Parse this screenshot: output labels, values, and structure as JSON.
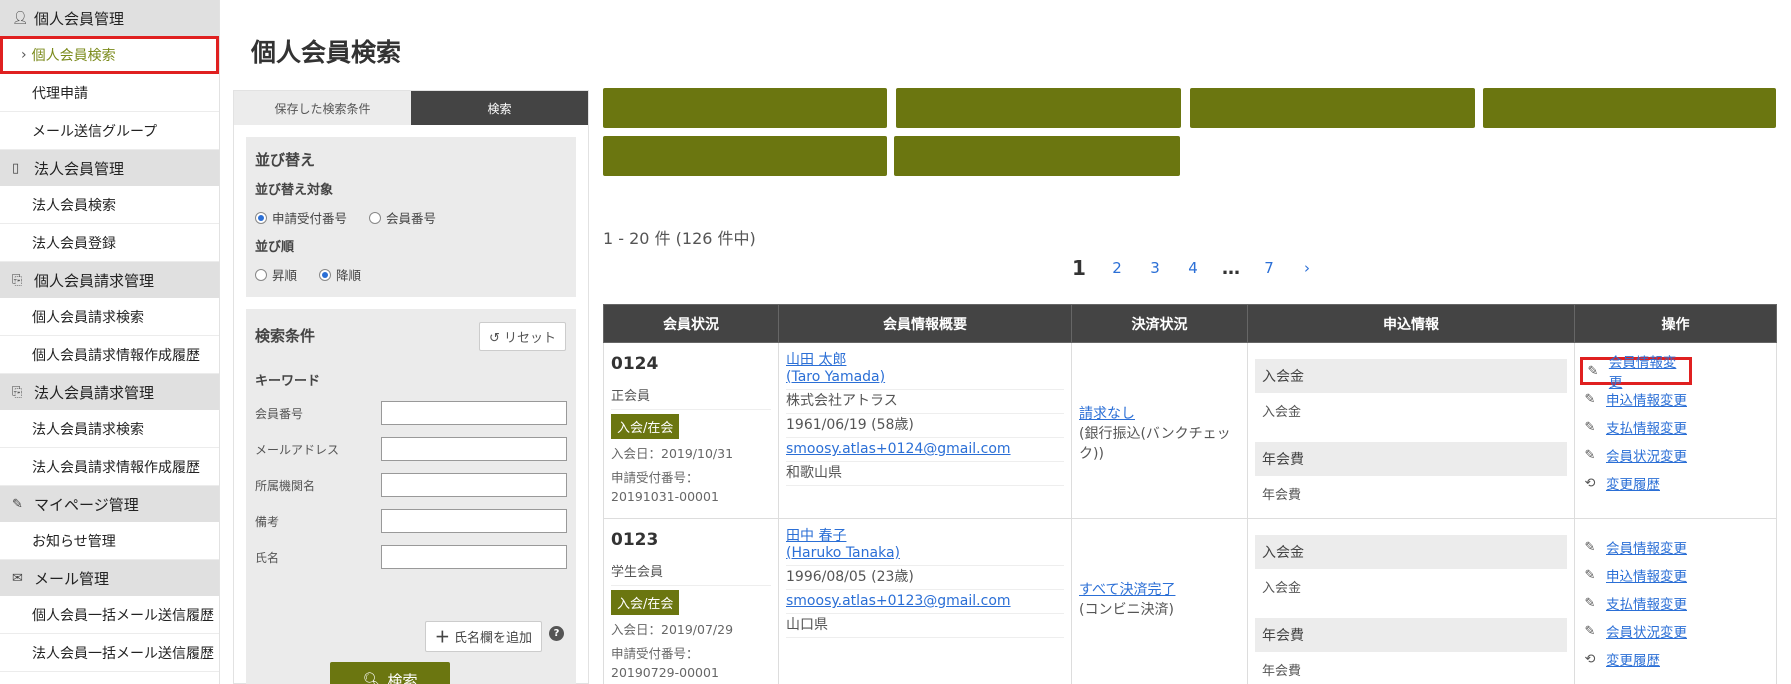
{
  "sidebar": {
    "sections": [
      {
        "icon": "person-icon",
        "label": "個人会員管理",
        "items": [
          {
            "label": "個人会員検索",
            "active": true
          },
          {
            "label": "代理申請"
          },
          {
            "label": "メール送信グループ"
          }
        ]
      },
      {
        "icon": "tablet-icon",
        "label": "法人会員管理",
        "items": [
          {
            "label": "法人会員検索"
          },
          {
            "label": "法人会員登録"
          }
        ]
      },
      {
        "icon": "document-icon",
        "label": "個人会員請求管理",
        "items": [
          {
            "label": "個人会員請求検索"
          },
          {
            "label": "個人会員請求情報作成履歴"
          }
        ]
      },
      {
        "icon": "document-icon",
        "label": "法人会員請求管理",
        "items": [
          {
            "label": "法人会員請求検索"
          },
          {
            "label": "法人会員請求情報作成履歴"
          }
        ]
      },
      {
        "icon": "pen-icon",
        "label": "マイページ管理",
        "items": [
          {
            "label": "お知らせ管理"
          }
        ]
      },
      {
        "icon": "mail-icon",
        "label": "メール管理",
        "items": [
          {
            "label": "個人会員一括メール送信履歴"
          },
          {
            "label": "法人会員一括メール送信履歴"
          }
        ]
      }
    ],
    "chevron": "›"
  },
  "page_title": "個人会員検索",
  "search_panel": {
    "tabs": [
      {
        "label": "保存した検索条件",
        "selected": false
      },
      {
        "label": "検索",
        "selected": true
      }
    ],
    "sort": {
      "heading": "並び替え",
      "target_label": "並び替え対象",
      "target_options": [
        {
          "label": "申請受付番号",
          "checked": true
        },
        {
          "label": "会員番号",
          "checked": false
        }
      ],
      "order_label": "並び順",
      "order_options": [
        {
          "label": "昇順",
          "checked": false
        },
        {
          "label": "降順",
          "checked": true
        }
      ]
    },
    "conditions": {
      "heading": "検索条件",
      "reset_label": "リセット",
      "keyword_label": "キーワード",
      "fields": [
        {
          "label": "会員番号",
          "value": ""
        },
        {
          "label": "メールアドレス",
          "value": ""
        },
        {
          "label": "所属機関名",
          "value": ""
        },
        {
          "label": "備考",
          "value": ""
        },
        {
          "label": "氏名",
          "value": ""
        }
      ],
      "add_name_label": "氏名欄を追加",
      "help_glyph": "?",
      "search_label": "検索"
    }
  },
  "results": {
    "count_text": "1 - 20 件 (126 件中)",
    "pagination": [
      "1",
      "2",
      "3",
      "4",
      "…",
      "7",
      "›"
    ],
    "current_page": "1",
    "columns": [
      "会員状況",
      "会員情報概要",
      "決済状況",
      "申込情報",
      "操作"
    ],
    "rows": [
      {
        "member_no": "0124",
        "member_type": "正会員",
        "badge": "入会/在会",
        "join_date": "入会日：2019/10/31",
        "app_no_label": "申請受付番号：",
        "app_no": "20191031-00001",
        "name": "山田 太郎",
        "name_roman": "(Taro Yamada)",
        "company": "株式会社アトラス",
        "birth": "1961/06/19 (58歳)",
        "email": "smoosy.atlas+0124@gmail.com",
        "pref": "和歌山県",
        "payment_status": "請求なし",
        "payment_method": "(銀行振込(バンクチェック))",
        "app_groups": [
          {
            "title": "入会金",
            "value": "入会金"
          },
          {
            "title": "年会費",
            "value": "年会費"
          }
        ],
        "highlight_first_op": true
      },
      {
        "member_no": "0123",
        "member_type": "学生会員",
        "badge": "入会/在会",
        "join_date": "入会日：2019/07/29",
        "app_no_label": "申請受付番号：",
        "app_no": "20190729-00001",
        "name": "田中 春子",
        "name_roman": "(Haruko Tanaka)",
        "company": "",
        "birth": "1996/08/05 (23歳)",
        "email": "smoosy.atlas+0123@gmail.com",
        "pref": "山口県",
        "payment_status": "すべて決済完了",
        "payment_method": "(コンビニ決済)",
        "app_groups": [
          {
            "title": "入会金",
            "value": "入会金"
          },
          {
            "title": "年会費",
            "value": "年会費"
          }
        ],
        "highlight_first_op": false
      }
    ],
    "operations": [
      {
        "icon": "pencil-icon",
        "label": "会員情報変更"
      },
      {
        "icon": "pencil-icon",
        "label": "申込情報変更"
      },
      {
        "icon": "pencil-icon",
        "label": "支払情報変更"
      },
      {
        "icon": "pencil-icon",
        "label": "会員状況変更"
      },
      {
        "icon": "history-icon",
        "label": "変更履歴"
      }
    ]
  },
  "colors": {
    "accent": "#6b7610",
    "highlight": "#e02020",
    "link": "#2b6fd6",
    "header_bg": "#444444"
  }
}
